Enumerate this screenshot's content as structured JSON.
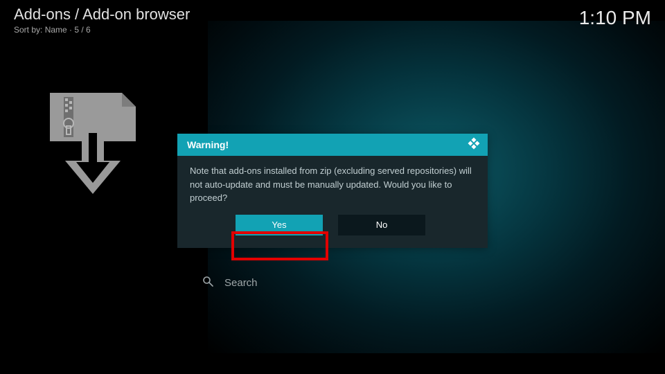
{
  "header": {
    "breadcrumb": "Add-ons / Add-on browser",
    "sort_prefix": "Sort by: ",
    "sort_field": "Name",
    "separator": "  ·  ",
    "position": "5 / 6"
  },
  "clock": "1:10 PM",
  "dialog": {
    "title": "Warning!",
    "message": "Note that add-ons installed from zip (excluding served repositories) will not auto-update and must be manually updated. Would you like to proceed?",
    "yes_label": "Yes",
    "no_label": "No"
  },
  "search": {
    "placeholder": "Search"
  },
  "icons": {
    "zip_download": "zip-download",
    "kodi_logo": "kodi-logo",
    "search": "search"
  },
  "colors": {
    "accent": "#12a2b4",
    "highlight": "#e20000"
  }
}
